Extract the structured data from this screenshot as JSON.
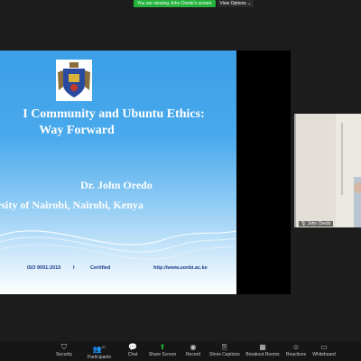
{
  "meeting": {
    "viewing_banner": "You are viewing John Oredo's screen",
    "view_options_label": "View Options"
  },
  "slide": {
    "title_line1": "I Community and Ubuntu Ethics:",
    "title_line2": "Way Forward",
    "author": "Dr. John Oredo",
    "affiliation": "rsity of Nairobi, Nairobi, Kenya",
    "footer_iso": "ISO 9001:2015",
    "footer_sep": "I",
    "footer_certified": "Certified",
    "footer_url": "http://www.uonbi.ac.ke",
    "background_color": "#49a9ec",
    "title_color": "#ffffff"
  },
  "participant_video": {
    "name": "John Oredo"
  },
  "toolbar": {
    "security": "Security",
    "participants": "Participants",
    "participants_count": "27",
    "chat": "Chat",
    "share_screen": "Share Screen",
    "record": "Record",
    "show_captions": "Show Captions",
    "breakout_rooms": "Breakout Rooms",
    "reactions": "Reactions",
    "whiteboard": "Whiteboard",
    "share_accent": "#24b23b"
  }
}
